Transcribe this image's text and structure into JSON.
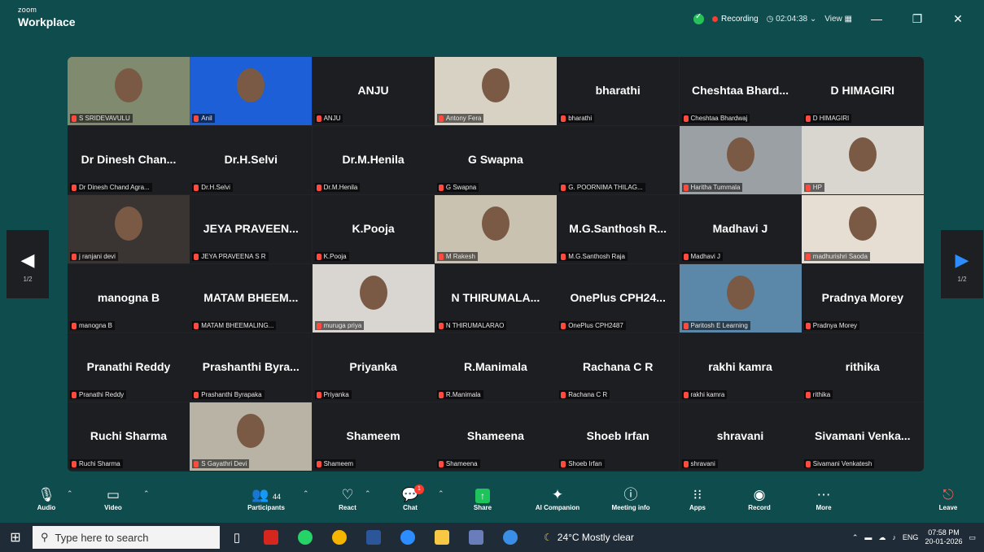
{
  "titlebar": {
    "brand_top": "zoom",
    "brand_main": "Workplace",
    "recording": "Recording",
    "timer": "02:04:38",
    "view": "View",
    "minimize": "—",
    "restore": "❐",
    "close": "✕"
  },
  "nav": {
    "left_page": "1/2",
    "right_page": "1/2"
  },
  "tiles": [
    {
      "label": "S SRIDEVAVULU",
      "big": "",
      "video": true
    },
    {
      "label": "Anil",
      "big": "",
      "video": true
    },
    {
      "label": "ANJU",
      "big": "ANJU"
    },
    {
      "label": "Antony Fera",
      "big": "",
      "video": true
    },
    {
      "label": "bharathi",
      "big": "bharathi"
    },
    {
      "label": "Cheshtaa Bhardwaj",
      "big": "Cheshtaa  Bhard..."
    },
    {
      "label": "D HIMAGIRI",
      "big": "D HIMAGIRI"
    },
    {
      "label": "Dr Dinesh Chand Agra...",
      "big": "Dr Dinesh  Chan..."
    },
    {
      "label": "Dr.H.Selvi",
      "big": "Dr.H.Selvi"
    },
    {
      "label": "Dr.M.Henila",
      "big": "Dr.M.Henila"
    },
    {
      "label": "G Swapna",
      "big": "G Swapna"
    },
    {
      "label": "G. POORNIMA THILAG...",
      "big": ""
    },
    {
      "label": "Haritha Tummala",
      "big": "",
      "video": true
    },
    {
      "label": "HP",
      "big": "",
      "video": true
    },
    {
      "label": "j ranjani devi",
      "big": "",
      "video": true
    },
    {
      "label": "JEYA PRAVEENA S R",
      "big": "JEYA  PRAVEEN..."
    },
    {
      "label": "K.Pooja",
      "big": "K.Pooja"
    },
    {
      "label": "M Rakesh",
      "big": "",
      "video": true
    },
    {
      "label": "M.G.Santhosh Raja",
      "big": "M.G.Santhosh  R..."
    },
    {
      "label": "Madhavi J",
      "big": "Madhavi J"
    },
    {
      "label": "madhurishri Saoda",
      "big": "",
      "video": true
    },
    {
      "label": "manogna B",
      "big": "manogna B"
    },
    {
      "label": "MATAM BHEEMALING...",
      "big": "MATAM  BHEEM..."
    },
    {
      "label": "muruga priya",
      "big": "",
      "video": true
    },
    {
      "label": "N THIRUMALARAO",
      "big": "N  THIRUMALA..."
    },
    {
      "label": "OnePlus CPH2487",
      "big": "OnePlus  CPH24..."
    },
    {
      "label": "Paritosh E Learning",
      "big": "",
      "video": true
    },
    {
      "label": "Pradnya Morey",
      "big": "Pradnya Morey"
    },
    {
      "label": "Pranathi Reddy",
      "big": "Pranathi Reddy"
    },
    {
      "label": "Prashanthi Byrapaka",
      "big": "Prashanthi  Byra..."
    },
    {
      "label": "Priyanka",
      "big": "Priyanka"
    },
    {
      "label": "R.Manimala",
      "big": "R.Manimala"
    },
    {
      "label": "Rachana C R",
      "big": "Rachana C R"
    },
    {
      "label": "rakhi kamra",
      "big": "rakhi kamra"
    },
    {
      "label": "rithika",
      "big": "rithika"
    },
    {
      "label": "Ruchi Sharma",
      "big": "Ruchi Sharma"
    },
    {
      "label": "S Gayathri Devi",
      "big": "",
      "video": true
    },
    {
      "label": "Shameem",
      "big": "Shameem"
    },
    {
      "label": "Shameena",
      "big": "Shameena"
    },
    {
      "label": "Shoeb Irfan",
      "big": "Shoeb Irfan"
    },
    {
      "label": "shravani",
      "big": "shravani"
    },
    {
      "label": "Sivamani Venkatesh",
      "big": "Sivamani  Venka..."
    }
  ],
  "toolbar": {
    "audio": "Audio",
    "video": "Video",
    "participants": "Participants",
    "participants_count": "44",
    "react": "React",
    "chat": "Chat",
    "chat_badge": "1",
    "share": "Share",
    "ai": "AI Companion",
    "meeting_info": "Meeting info",
    "apps": "Apps",
    "record": "Record",
    "more": "More",
    "leave": "Leave"
  },
  "taskbar": {
    "search_placeholder": "Type here to search",
    "weather": "24°C  Mostly clear",
    "lang": "ENG",
    "time": "07:58 PM",
    "date": "20-01-2026"
  }
}
